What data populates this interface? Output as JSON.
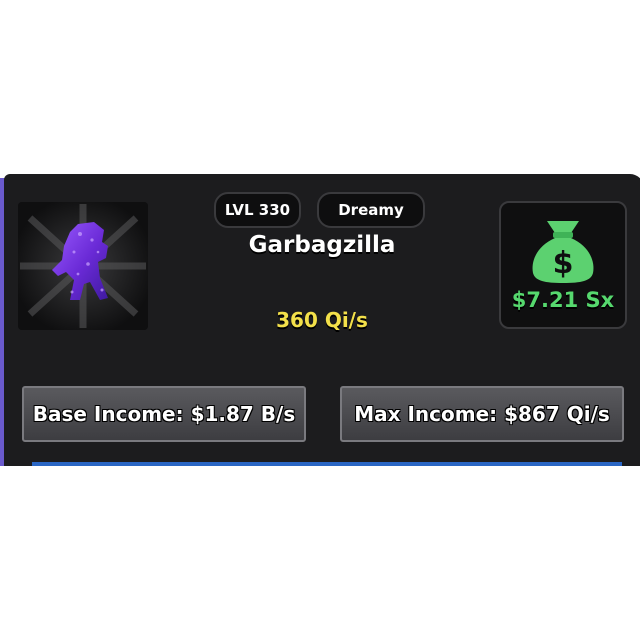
{
  "card": {
    "level": "LVL 330",
    "mutation": "Dreamy",
    "name": "Garbagzilla",
    "rate": "360 Qi/s",
    "cash_icon": "money-bag-icon",
    "cash_value": "$7.21 Sx",
    "base_income": "Base Income: $1.87 B/s",
    "max_income": "Max Income: $867 Qi/s"
  },
  "colors": {
    "panel": "#1c1c1e",
    "rate": "#f3e04a",
    "cash": "#56d86e",
    "character": "#7b3fe0"
  }
}
